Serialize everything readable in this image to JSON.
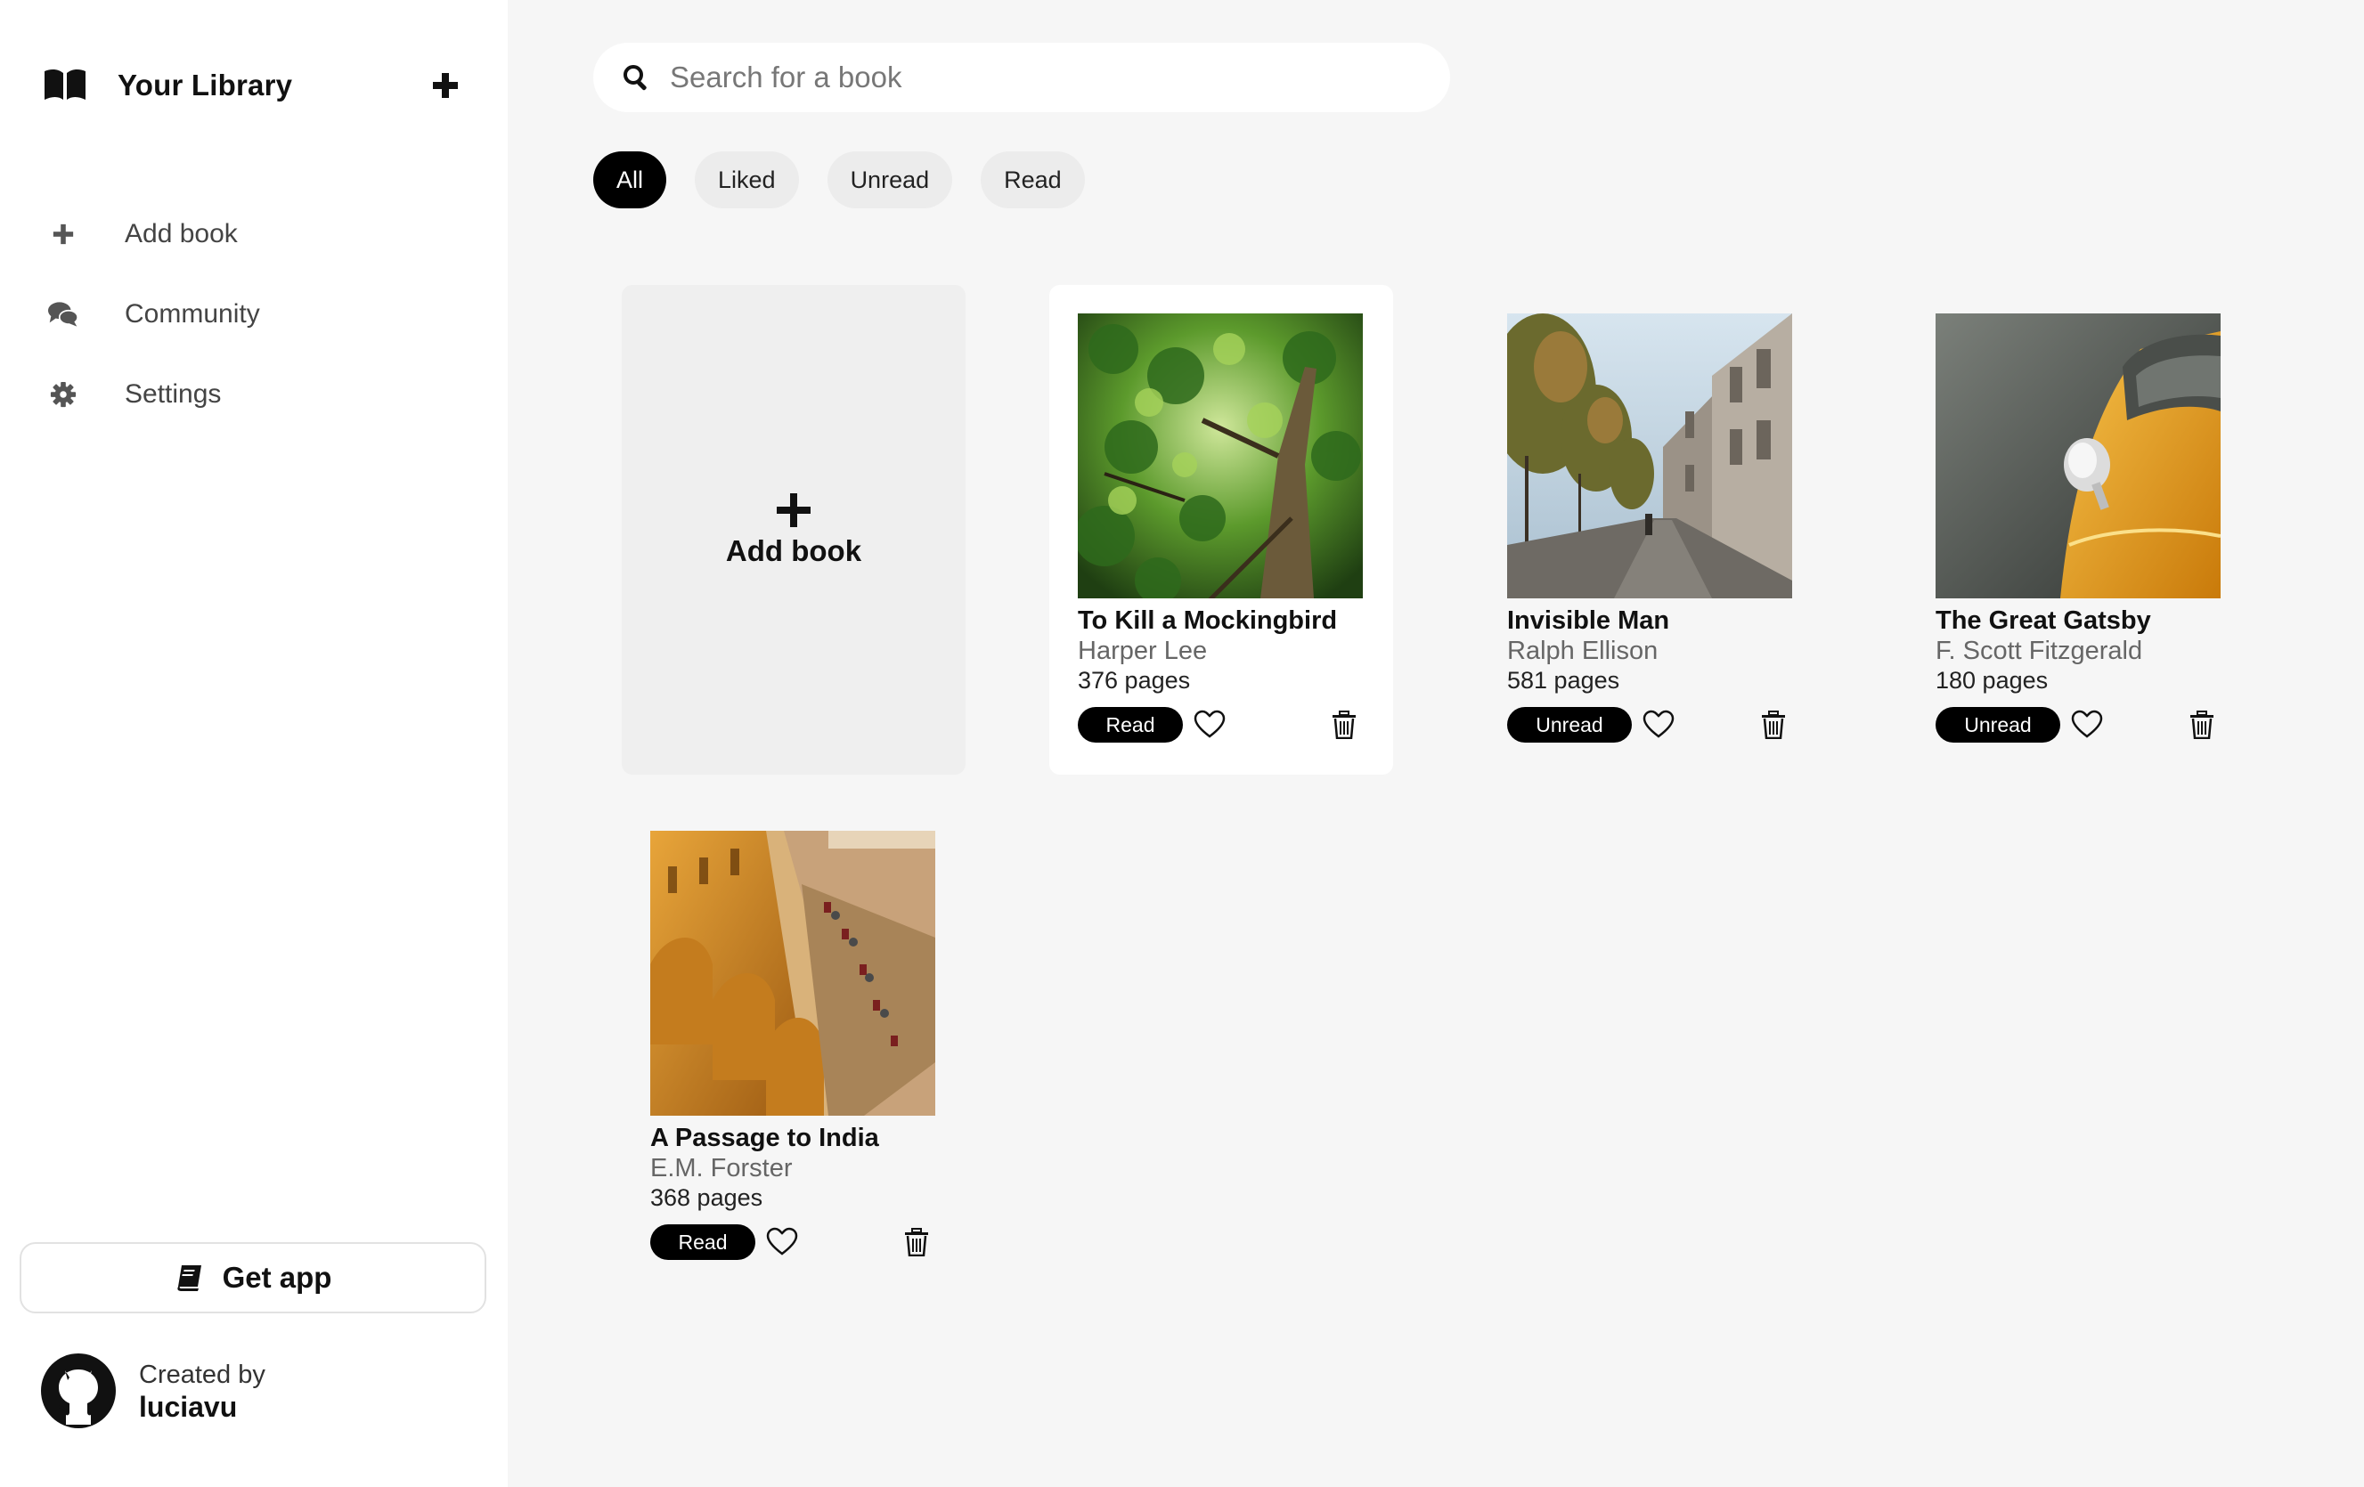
{
  "sidebar": {
    "brand": {
      "title": "Your Library",
      "icon": "book-open-icon",
      "add_icon": "plus-icon"
    },
    "nav": [
      {
        "label": "Add book",
        "icon": "plus-icon"
      },
      {
        "label": "Community",
        "icon": "chat-bubbles-icon"
      },
      {
        "label": "Settings",
        "icon": "gear-icon"
      }
    ],
    "get_app": {
      "label": "Get app",
      "icon": "book-icon"
    },
    "creator": {
      "line1": "Created by",
      "name": "luciavu",
      "icon": "github-icon"
    }
  },
  "search": {
    "placeholder": "Search for a book",
    "value": "",
    "icon": "search-icon"
  },
  "filters": [
    {
      "label": "All",
      "active": true
    },
    {
      "label": "Liked",
      "active": false
    },
    {
      "label": "Unread",
      "active": false
    },
    {
      "label": "Read",
      "active": false
    }
  ],
  "add_card": {
    "label": "Add book",
    "icon": "plus-icon"
  },
  "books": [
    {
      "title": "To Kill a Mockingbird",
      "author": "Harper Lee",
      "pages": "376 pages",
      "status": "Read",
      "liked": false,
      "cover": "tree-canopy"
    },
    {
      "title": "Invisible Man",
      "author": "Ralph Ellison",
      "pages": "581 pages",
      "status": "Unread",
      "liked": false,
      "cover": "city-street"
    },
    {
      "title": "The Great Gatsby",
      "author": "F. Scott Fitzgerald",
      "pages": "180 pages",
      "status": "Unread",
      "liked": false,
      "cover": "yellow-car"
    },
    {
      "title": "A Passage to India",
      "author": "E.M. Forster",
      "pages": "368 pages",
      "status": "Read",
      "liked": false,
      "cover": "fort-wall"
    }
  ],
  "colors": {
    "accent": "#000000",
    "sidebar_bg": "#ffffff",
    "main_bg": "#f6f6f6",
    "chip_bg": "#ececec"
  }
}
